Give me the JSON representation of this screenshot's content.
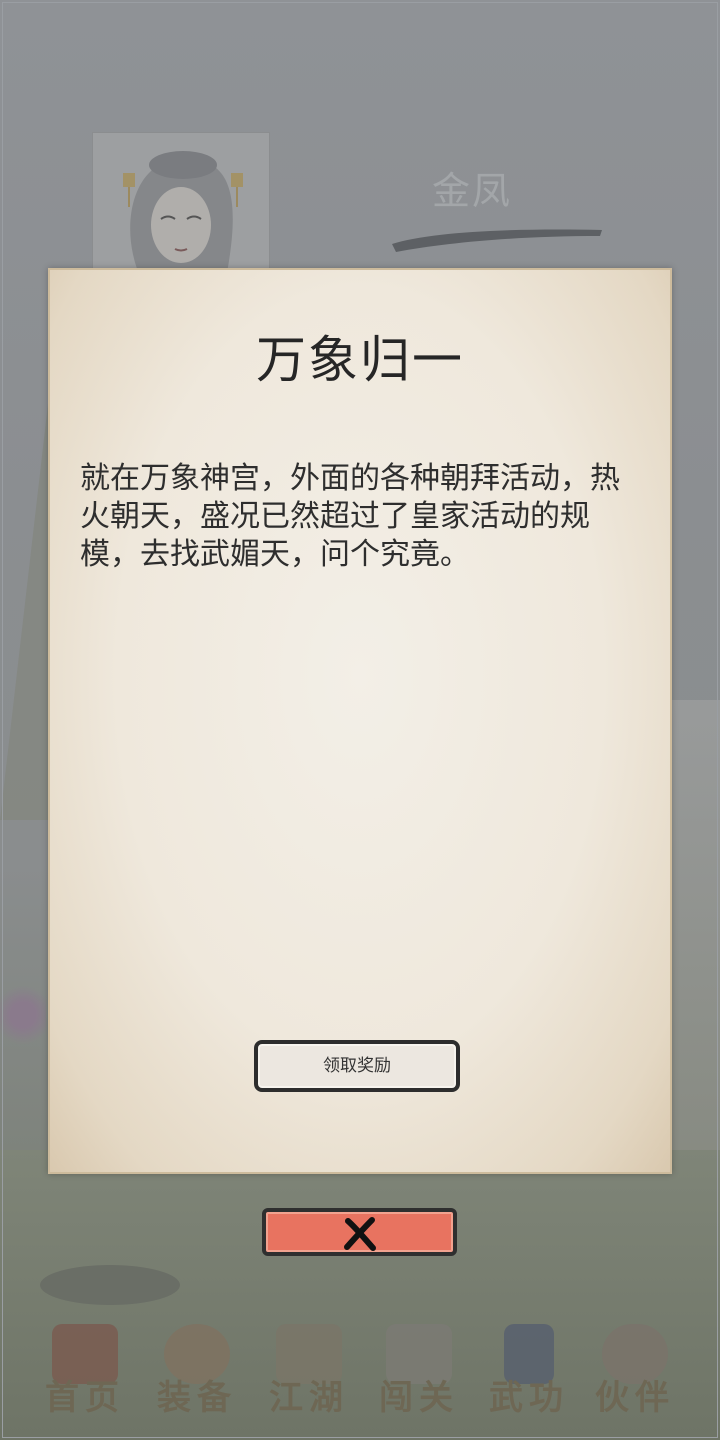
{
  "background": {
    "character_name": "金凤"
  },
  "modal": {
    "title": "万象归一",
    "body": "就在万象神宫，外面的各种朝拜活动，热火朝天，盛况已然超过了皇家活动的规模，去找武媚天，问个究竟。",
    "claim_button_label": "领取奖励",
    "close_icon": "close-icon"
  },
  "nav": {
    "items": [
      {
        "label": "首页",
        "icon": "home-icon"
      },
      {
        "label": "装备",
        "icon": "equipment-icon"
      },
      {
        "label": "江湖",
        "icon": "jianghu-icon"
      },
      {
        "label": "闯关",
        "icon": "stage-icon"
      },
      {
        "label": "武功",
        "icon": "martial-arts-icon"
      },
      {
        "label": "伙伴",
        "icon": "partners-icon"
      }
    ]
  },
  "colors": {
    "close_button": "#e87360",
    "paper": "#efe8dc",
    "text": "#2e2e2e"
  }
}
